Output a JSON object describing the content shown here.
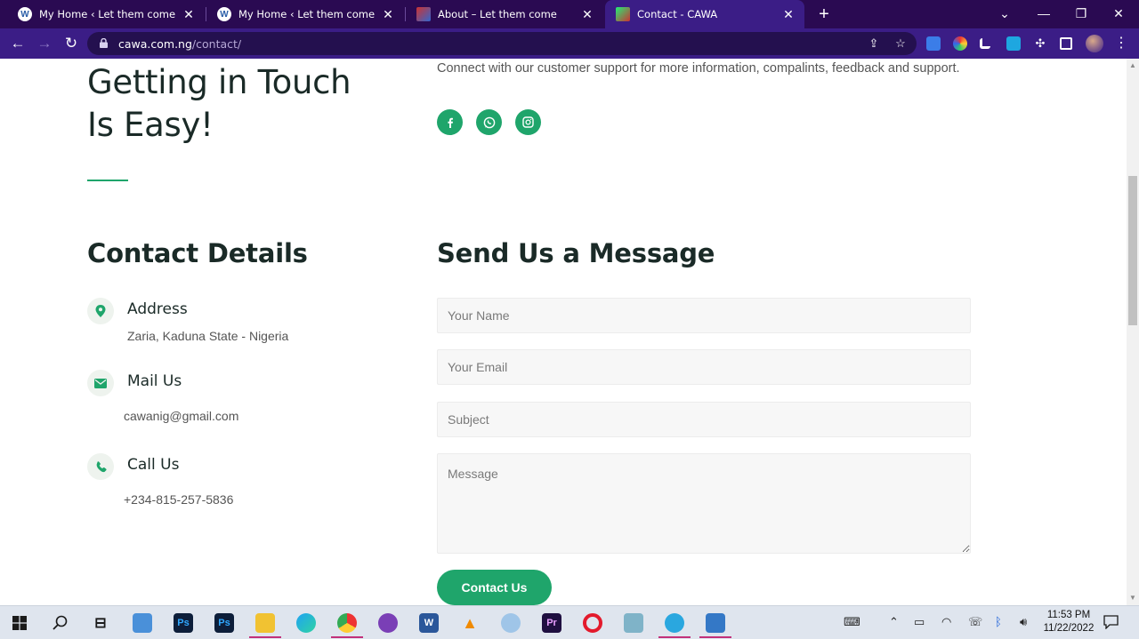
{
  "browser": {
    "tabs": [
      {
        "title": "My Home ‹ Let them come — WordPress",
        "icon": "wordpress-icon",
        "active": false
      },
      {
        "title": "My Home ‹ Let them come — WordPress",
        "icon": "wordpress-icon",
        "active": false
      },
      {
        "title": "About – Let them come",
        "icon": "site-favicon",
        "active": false
      },
      {
        "title": "Contact - CAWA",
        "icon": "cawa-favicon",
        "active": true
      }
    ],
    "url_host": "cawa.com.ng",
    "url_path": "/contact/"
  },
  "hero": {
    "title_line1": "Getting in Touch",
    "title_line2": "Is Easy!",
    "intro": "Connect with our customer support for more information, compalints, feedback and support.",
    "social": [
      "facebook-icon",
      "whatsapp-icon",
      "instagram-icon"
    ]
  },
  "contact_details": {
    "title": "Contact Details",
    "items": [
      {
        "label": "Address",
        "value": "Zaria, Kaduna State - Nigeria",
        "icon": "map-pin-icon"
      },
      {
        "label": "Mail Us",
        "value": "cawanig@gmail.com",
        "icon": "envelope-icon"
      },
      {
        "label": "Call Us",
        "value": "+234-815-257-5836",
        "icon": "phone-icon"
      }
    ]
  },
  "form": {
    "title": "Send Us a Message",
    "name_placeholder": "Your Name",
    "email_placeholder": "Your Email",
    "subject_placeholder": "Subject",
    "message_placeholder": "Message",
    "submit_label": "Contact Us"
  },
  "taskbar": {
    "time": "11:53 PM",
    "date": "11/22/2022"
  },
  "colors": {
    "accent": "#1fa56b",
    "browser_frame": "#3b1d86",
    "tabstrip": "#2a0a52"
  }
}
